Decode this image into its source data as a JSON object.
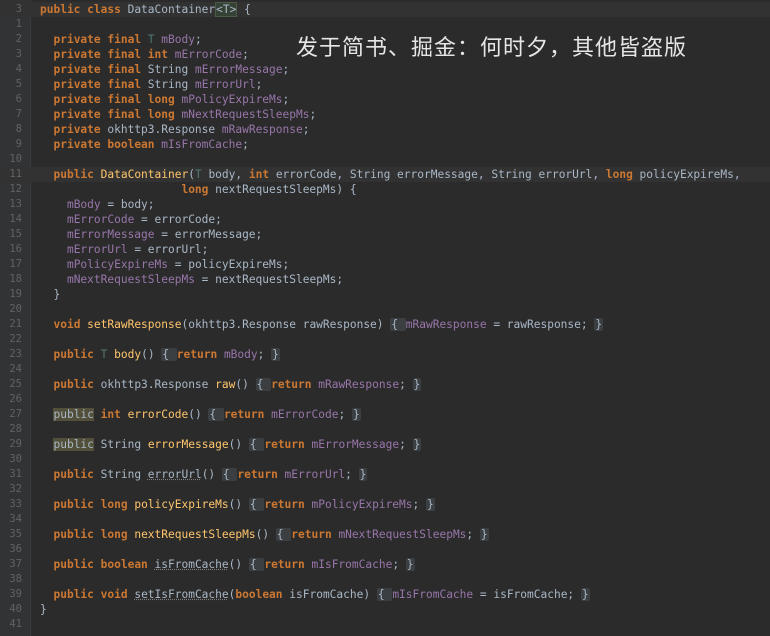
{
  "watermark": "发于简书、掘金：何时夕，其他皆盗版",
  "lines": [
    {
      "n": "3",
      "tokens": [
        [
          "kw",
          "public "
        ],
        [
          "kw",
          "class "
        ],
        [
          "cls",
          "DataContainer"
        ],
        [
          "caret-box",
          "<T>"
        ],
        [
          "pun",
          " {"
        ]
      ],
      "hl": true
    },
    {
      "n": "1",
      "tokens": []
    },
    {
      "n": "2",
      "tokens": [
        [
          "sp",
          "  "
        ],
        [
          "kw",
          "private "
        ],
        [
          "kw",
          "final "
        ],
        [
          "tp",
          "T "
        ],
        [
          "fld",
          "mBody"
        ],
        [
          "pun",
          ";"
        ]
      ]
    },
    {
      "n": "3",
      "tokens": [
        [
          "sp",
          "  "
        ],
        [
          "kw",
          "private "
        ],
        [
          "kw",
          "final "
        ],
        [
          "kw",
          "int "
        ],
        [
          "fld",
          "mErrorCode"
        ],
        [
          "pun",
          ";"
        ]
      ]
    },
    {
      "n": "4",
      "tokens": [
        [
          "sp",
          "  "
        ],
        [
          "kw",
          "private "
        ],
        [
          "kw",
          "final "
        ],
        [
          "cls",
          "String "
        ],
        [
          "fld",
          "mErrorMessage"
        ],
        [
          "pun",
          ";"
        ]
      ]
    },
    {
      "n": "5",
      "tokens": [
        [
          "sp",
          "  "
        ],
        [
          "kw",
          "private "
        ],
        [
          "kw",
          "final "
        ],
        [
          "cls",
          "String "
        ],
        [
          "fld",
          "mErrorUrl"
        ],
        [
          "pun",
          ";"
        ]
      ]
    },
    {
      "n": "6",
      "tokens": [
        [
          "sp",
          "  "
        ],
        [
          "kw",
          "private "
        ],
        [
          "kw",
          "final "
        ],
        [
          "kw",
          "long "
        ],
        [
          "fld",
          "mPolicyExpireMs"
        ],
        [
          "pun",
          ";"
        ]
      ]
    },
    {
      "n": "7",
      "tokens": [
        [
          "sp",
          "  "
        ],
        [
          "kw",
          "private "
        ],
        [
          "kw",
          "final "
        ],
        [
          "kw",
          "long "
        ],
        [
          "fld",
          "mNextRequestSleepMs"
        ],
        [
          "pun",
          ";"
        ]
      ]
    },
    {
      "n": "8",
      "tokens": [
        [
          "sp",
          "  "
        ],
        [
          "kw",
          "private "
        ],
        [
          "cls",
          "okhttp3.Response "
        ],
        [
          "fld",
          "mRawResponse"
        ],
        [
          "pun",
          ";"
        ]
      ]
    },
    {
      "n": "9",
      "tokens": [
        [
          "sp",
          "  "
        ],
        [
          "kw",
          "private "
        ],
        [
          "kw",
          "boolean "
        ],
        [
          "fld",
          "mIsFromCache"
        ],
        [
          "pun",
          ";"
        ]
      ]
    },
    {
      "n": "10",
      "tokens": []
    },
    {
      "n": "11",
      "tokens": [
        [
          "sp",
          "  "
        ],
        [
          "kw",
          "public "
        ],
        [
          "fn",
          "DataContainer"
        ],
        [
          "pun",
          "("
        ],
        [
          "tp",
          "T "
        ],
        [
          "cls",
          "body, "
        ],
        [
          "kw",
          "int "
        ],
        [
          "cls",
          "errorCode, String errorMessage, String errorUrl, "
        ],
        [
          "kw",
          "long "
        ],
        [
          "cls",
          "policyExpireMs,"
        ]
      ],
      "hl": true
    },
    {
      "n": "12",
      "tokens": [
        [
          "sp",
          "                     "
        ],
        [
          "kw",
          "long "
        ],
        [
          "cls",
          "nextRequestSleepMs) {"
        ]
      ]
    },
    {
      "n": "13",
      "tokens": [
        [
          "sp",
          "    "
        ],
        [
          "fld",
          "mBody"
        ],
        [
          "pun",
          " = body;"
        ]
      ]
    },
    {
      "n": "14",
      "tokens": [
        [
          "sp",
          "    "
        ],
        [
          "fld",
          "mErrorCode"
        ],
        [
          "pun",
          " = errorCode;"
        ]
      ]
    },
    {
      "n": "15",
      "tokens": [
        [
          "sp",
          "    "
        ],
        [
          "fld",
          "mErrorMessage"
        ],
        [
          "pun",
          " = errorMessage;"
        ]
      ]
    },
    {
      "n": "16",
      "tokens": [
        [
          "sp",
          "    "
        ],
        [
          "fld",
          "mErrorUrl"
        ],
        [
          "pun",
          " = errorUrl;"
        ]
      ]
    },
    {
      "n": "17",
      "tokens": [
        [
          "sp",
          "    "
        ],
        [
          "fld",
          "mPolicyExpireMs"
        ],
        [
          "pun",
          " = policyExpireMs;"
        ]
      ]
    },
    {
      "n": "18",
      "tokens": [
        [
          "sp",
          "    "
        ],
        [
          "fld",
          "mNextRequestSleepMs"
        ],
        [
          "pun",
          " = nextRequestSleepMs;"
        ]
      ]
    },
    {
      "n": "19",
      "tokens": [
        [
          "sp",
          "  "
        ],
        [
          "pun",
          "}"
        ]
      ]
    },
    {
      "n": "20",
      "tokens": []
    },
    {
      "n": "21",
      "tokens": [
        [
          "sp",
          "  "
        ],
        [
          "kw",
          "void "
        ],
        [
          "fn",
          "setRawResponse"
        ],
        [
          "pun",
          "(okhttp3.Response rawResponse) "
        ],
        [
          "fold",
          "{ "
        ],
        [
          "fld",
          "mRawResponse"
        ],
        [
          "pun",
          " = rawResponse; "
        ],
        [
          "fold",
          "}"
        ]
      ]
    },
    {
      "n": "22",
      "tokens": []
    },
    {
      "n": "23",
      "tokens": [
        [
          "sp",
          "  "
        ],
        [
          "kw",
          "public "
        ],
        [
          "tp",
          "T "
        ],
        [
          "fn",
          "body"
        ],
        [
          "pun",
          "() "
        ],
        [
          "fold",
          "{ "
        ],
        [
          "kw",
          "return "
        ],
        [
          "fld",
          "mBody"
        ],
        [
          "pun",
          "; "
        ],
        [
          "fold",
          "}"
        ]
      ]
    },
    {
      "n": "24",
      "tokens": []
    },
    {
      "n": "25",
      "tokens": [
        [
          "sp",
          "  "
        ],
        [
          "kw",
          "public "
        ],
        [
          "cls",
          "okhttp3.Response "
        ],
        [
          "fn",
          "raw"
        ],
        [
          "pun",
          "() "
        ],
        [
          "fold",
          "{ "
        ],
        [
          "kw",
          "return "
        ],
        [
          "fld",
          "mRawResponse"
        ],
        [
          "pun",
          "; "
        ],
        [
          "fold",
          "}"
        ]
      ]
    },
    {
      "n": "26",
      "tokens": []
    },
    {
      "n": "27",
      "tokens": [
        [
          "sp",
          "  "
        ],
        [
          "kwbox",
          "public"
        ],
        [
          "pun",
          " "
        ],
        [
          "kw",
          "int "
        ],
        [
          "fn",
          "errorCode"
        ],
        [
          "pun",
          "() "
        ],
        [
          "fold",
          "{ "
        ],
        [
          "kw",
          "return "
        ],
        [
          "fld",
          "mErrorCode"
        ],
        [
          "pun",
          "; "
        ],
        [
          "fold",
          "}"
        ]
      ]
    },
    {
      "n": "28",
      "tokens": []
    },
    {
      "n": "29",
      "tokens": [
        [
          "sp",
          "  "
        ],
        [
          "kwbox",
          "public"
        ],
        [
          "pun",
          " "
        ],
        [
          "cls",
          "String "
        ],
        [
          "fn",
          "errorMessage"
        ],
        [
          "pun",
          "() "
        ],
        [
          "fold",
          "{ "
        ],
        [
          "kw",
          "return "
        ],
        [
          "fld",
          "mErrorMessage"
        ],
        [
          "pun",
          "; "
        ],
        [
          "fold",
          "}"
        ]
      ]
    },
    {
      "n": "30",
      "tokens": []
    },
    {
      "n": "31",
      "tokens": [
        [
          "sp",
          "  "
        ],
        [
          "kw",
          "public "
        ],
        [
          "cls",
          "String "
        ],
        [
          "und",
          "errorUrl"
        ],
        [
          "pun",
          "() "
        ],
        [
          "fold",
          "{ "
        ],
        [
          "kw",
          "return "
        ],
        [
          "fld",
          "mErrorUrl"
        ],
        [
          "pun",
          "; "
        ],
        [
          "fold",
          "}"
        ]
      ]
    },
    {
      "n": "32",
      "tokens": []
    },
    {
      "n": "33",
      "tokens": [
        [
          "sp",
          "  "
        ],
        [
          "kw",
          "public "
        ],
        [
          "kw",
          "long "
        ],
        [
          "fn",
          "policyExpireMs"
        ],
        [
          "pun",
          "() "
        ],
        [
          "fold",
          "{ "
        ],
        [
          "kw",
          "return "
        ],
        [
          "fld",
          "mPolicyExpireMs"
        ],
        [
          "pun",
          "; "
        ],
        [
          "fold",
          "}"
        ]
      ]
    },
    {
      "n": "34",
      "tokens": []
    },
    {
      "n": "35",
      "tokens": [
        [
          "sp",
          "  "
        ],
        [
          "kw",
          "public "
        ],
        [
          "kw",
          "long "
        ],
        [
          "fn",
          "nextRequestSleepMs"
        ],
        [
          "pun",
          "() "
        ],
        [
          "fold",
          "{ "
        ],
        [
          "kw",
          "return "
        ],
        [
          "fld",
          "mNextRequestSleepMs"
        ],
        [
          "pun",
          "; "
        ],
        [
          "fold",
          "}"
        ]
      ]
    },
    {
      "n": "36",
      "tokens": []
    },
    {
      "n": "37",
      "tokens": [
        [
          "sp",
          "  "
        ],
        [
          "kw",
          "public "
        ],
        [
          "kw",
          "boolean "
        ],
        [
          "und",
          "isFromCache"
        ],
        [
          "pun",
          "() "
        ],
        [
          "fold",
          "{ "
        ],
        [
          "kw",
          "return "
        ],
        [
          "fld",
          "mIsFromCache"
        ],
        [
          "pun",
          "; "
        ],
        [
          "fold",
          "}"
        ]
      ]
    },
    {
      "n": "38",
      "tokens": []
    },
    {
      "n": "39",
      "tokens": [
        [
          "sp",
          "  "
        ],
        [
          "kw",
          "public "
        ],
        [
          "kw",
          "void "
        ],
        [
          "und",
          "setIsFromCache"
        ],
        [
          "pun",
          "("
        ],
        [
          "kw",
          "boolean "
        ],
        [
          "cls",
          "isFromCache) "
        ],
        [
          "fold",
          "{ "
        ],
        [
          "fld",
          "mIsFromCache"
        ],
        [
          "pun",
          " = isFromCache; "
        ],
        [
          "fold",
          "}"
        ]
      ]
    },
    {
      "n": "40",
      "tokens": [
        [
          "pun",
          "}"
        ]
      ]
    },
    {
      "n": "41",
      "tokens": []
    }
  ]
}
